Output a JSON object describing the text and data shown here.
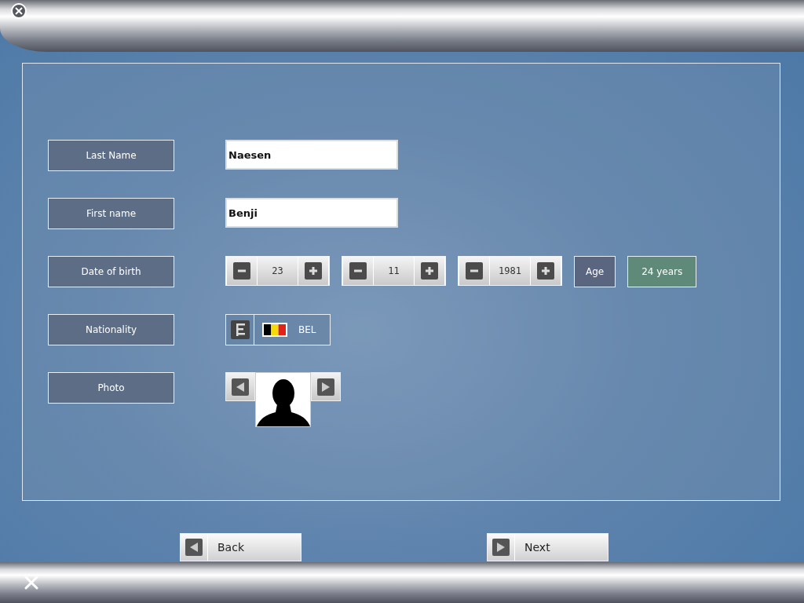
{
  "fields": [
    {
      "label": "Last Name",
      "kind": "text",
      "value": "Naesen"
    },
    {
      "label": "First name",
      "kind": "text",
      "value": "Benji"
    },
    {
      "label": "Date of birth",
      "kind": "date",
      "parts": [
        "23",
        "11",
        "1981"
      ],
      "age_label": "Age",
      "age": "24 years"
    },
    {
      "label": "Nationality",
      "kind": "nationality",
      "code": "BEL"
    },
    {
      "label": "Photo",
      "kind": "photo"
    }
  ],
  "buttons": [
    {
      "label": "Back",
      "kind": "back"
    },
    {
      "label": "Next",
      "kind": "next"
    }
  ]
}
